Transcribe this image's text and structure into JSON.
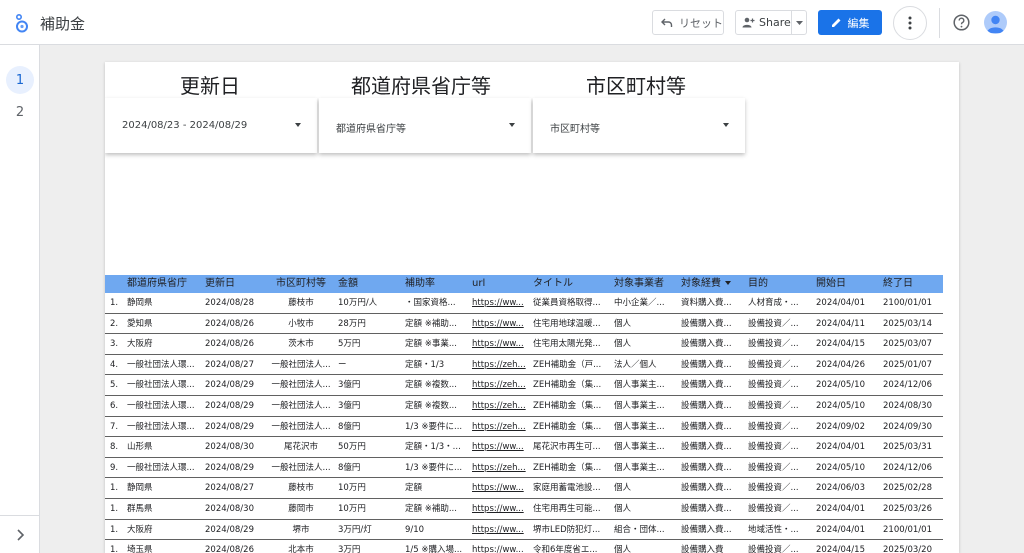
{
  "header": {
    "title": "補助金",
    "reset_label": "リセット",
    "share_label": "Share",
    "edit_label": "編集"
  },
  "rail": {
    "pages": [
      "1",
      "2"
    ]
  },
  "report": {
    "headings": [
      "更新日",
      "都道府県省庁等",
      "市区町村等"
    ],
    "filters": [
      {
        "value": "2024/08/23 - 2024/08/29"
      },
      {
        "value": "都道府県省庁等"
      },
      {
        "value": "市区町村等"
      }
    ],
    "table": {
      "columns": [
        "都道府県省庁",
        "更新日",
        "市区町村等",
        "金額",
        "補助率",
        "url",
        "タイトル",
        "対象事業者",
        "対象経費",
        "目的",
        "開始日",
        "終了日"
      ],
      "rows": [
        [
          "1.",
          "静岡県",
          "2024/08/28",
          "藤枝市",
          "10万円/人",
          "・国家資格...",
          "https://ww...",
          "従業員資格取得...",
          "中小企業／...",
          "資料購入費...",
          "人材育成・...",
          "2024/04/01",
          "2100/01/01"
        ],
        [
          "2.",
          "愛知県",
          "2024/08/26",
          "小牧市",
          "28万円",
          "定額 ※補助...",
          "https://ww...",
          "住宅用地球温暖...",
          "個人",
          "設備購入費...",
          "設備投資／...",
          "2024/04/11",
          "2025/03/14"
        ],
        [
          "3.",
          "大阪府",
          "2024/08/26",
          "茨木市",
          "5万円",
          "定額 ※事業...",
          "https://ww...",
          "住宅用太陽光発...",
          "個人",
          "設備購入費...",
          "設備投資／...",
          "2024/04/15",
          "2025/03/07"
        ],
        [
          "4.",
          "一般社団法人環...",
          "2024/08/27",
          "一般社団法人...",
          "ー",
          "定額・1/3",
          "https://zeh...",
          "ZEH補助金（戸...",
          "法人／個人",
          "設備購入費...",
          "設備投資／...",
          "2024/04/26",
          "2025/01/07"
        ],
        [
          "5.",
          "一般社団法人環...",
          "2024/08/29",
          "一般社団法人...",
          "3億円",
          "定額 ※複数...",
          "https://zeh...",
          "ZEH補助金（集...",
          "個人事業主...",
          "設備購入費...",
          "設備投資／...",
          "2024/05/10",
          "2024/12/06"
        ],
        [
          "6.",
          "一般社団法人環...",
          "2024/08/29",
          "一般社団法人...",
          "3億円",
          "定額 ※複数...",
          "https://zeh...",
          "ZEH補助金（集...",
          "個人事業主...",
          "設備購入費...",
          "設備投資／...",
          "2024/05/10",
          "2024/08/30"
        ],
        [
          "7.",
          "一般社団法人環...",
          "2024/08/29",
          "一般社団法人...",
          "8億円",
          "1/3 ※要件に...",
          "https://zeh...",
          "ZEH補助金（集...",
          "個人事業主...",
          "設備購入費...",
          "設備投資／...",
          "2024/09/02",
          "2024/09/30"
        ],
        [
          "8.",
          "山形県",
          "2024/08/30",
          "尾花沢市",
          "50万円",
          "定額・1/3・...",
          "https://ww...",
          "尾花沢市再生可...",
          "個人事業主...",
          "設備購入費...",
          "設備投資／...",
          "2024/04/01",
          "2025/03/31"
        ],
        [
          "9.",
          "一般社団法人環...",
          "2024/08/29",
          "一般社団法人...",
          "8億円",
          "1/3 ※要件に...",
          "https://zeh...",
          "ZEH補助金（集...",
          "個人事業主...",
          "設備購入費...",
          "設備投資／...",
          "2024/05/10",
          "2024/12/06"
        ],
        [
          "1.",
          "静岡県",
          "2024/08/27",
          "藤枝市",
          "10万円",
          "定額",
          "https://ww...",
          "家庭用蓄電池設...",
          "個人",
          "設備購入費...",
          "設備投資／...",
          "2024/06/03",
          "2025/02/28"
        ],
        [
          "1.",
          "群馬県",
          "2024/08/30",
          "藤岡市",
          "10万円",
          "定額 ※補助...",
          "https://ww...",
          "住宅用再生可能...",
          "個人",
          "設備購入費...",
          "設備投資／...",
          "2024/04/01",
          "2025/03/26"
        ],
        [
          "1.",
          "大阪府",
          "2024/08/29",
          "堺市",
          "3万円/灯",
          "9/10",
          "https://ww...",
          "堺市LED防犯灯...",
          "組合・団体...",
          "設備購入費...",
          "地域活性・...",
          "2024/04/01",
          "2100/01/01"
        ],
        [
          "1.",
          "埼玉県",
          "2024/08/26",
          "北本市",
          "3万円",
          "1/5 ※購入場...",
          "https://ww...",
          "令和6年度省エ...",
          "個人",
          "設備購入費",
          "設備投資／...",
          "2024/04/15",
          "2025/03/20"
        ]
      ]
    }
  },
  "icons": {
    "logo": "looker-studio-icon",
    "reset": "undo-icon",
    "share": "person-add-icon",
    "edit": "pencil-icon",
    "more": "more-vert-icon",
    "help": "help-icon",
    "avatar": "account-icon",
    "expand": "chevron-right-icon"
  },
  "colors": {
    "primary": "#1a73e8",
    "table_header": "#6fa8f0"
  }
}
